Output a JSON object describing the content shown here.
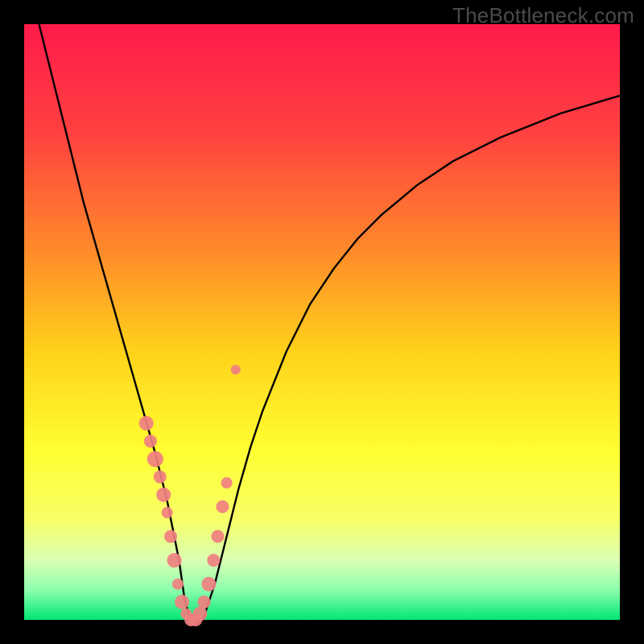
{
  "watermark": "TheBottleneck.com",
  "chart_data": {
    "type": "line",
    "title": "",
    "xlabel": "",
    "ylabel": "",
    "xlim": [
      0,
      100
    ],
    "ylim": [
      0,
      100
    ],
    "grid": false,
    "legend": false,
    "background": {
      "type": "vertical-gradient",
      "stops": [
        {
          "pos": 0.0,
          "color": "#ff1a4b"
        },
        {
          "pos": 0.18,
          "color": "#ff4040"
        },
        {
          "pos": 0.38,
          "color": "#ff8a2a"
        },
        {
          "pos": 0.55,
          "color": "#ffd21a"
        },
        {
          "pos": 0.72,
          "color": "#ffff33"
        },
        {
          "pos": 0.83,
          "color": "#f7ff66"
        },
        {
          "pos": 0.9,
          "color": "#d9ffb3"
        },
        {
          "pos": 0.95,
          "color": "#8cffad"
        },
        {
          "pos": 1.0,
          "color": "#00e676"
        }
      ]
    },
    "series": [
      {
        "name": "bottleneck-curve",
        "type": "line",
        "color": "#000000",
        "width": 2,
        "x": [
          2,
          4,
          6,
          8,
          10,
          12,
          14,
          16,
          18,
          20,
          22,
          24,
          26,
          27,
          28,
          30,
          32,
          34,
          36,
          38,
          40,
          44,
          48,
          52,
          56,
          60,
          66,
          72,
          80,
          90,
          100
        ],
        "y": [
          102,
          94,
          86,
          78,
          70,
          63,
          56,
          49,
          42,
          35,
          28,
          20,
          10,
          3,
          0,
          0,
          6,
          14,
          22,
          29,
          35,
          45,
          53,
          59,
          64,
          68,
          73,
          77,
          81,
          85,
          88
        ]
      },
      {
        "name": "highlight-dots",
        "type": "scatter",
        "color": "#f08080",
        "radius_range": [
          5,
          11
        ],
        "x": [
          20.5,
          21.2,
          22.0,
          22.8,
          23.4,
          24.0,
          24.6,
          25.2,
          25.8,
          26.5,
          27.2,
          28.0,
          28.8,
          29.5,
          30.2,
          31.0,
          31.8,
          32.5,
          33.3,
          34.0,
          35.5
        ],
        "y": [
          33,
          30,
          27,
          24,
          21,
          18,
          14,
          10,
          6,
          3,
          1,
          0,
          0,
          1,
          3,
          6,
          10,
          14,
          19,
          23,
          42
        ],
        "r": [
          9,
          8,
          10,
          8,
          9,
          7,
          8,
          9,
          7,
          9,
          7,
          8,
          8,
          9,
          8,
          9,
          8,
          8,
          8,
          7,
          6
        ]
      }
    ]
  }
}
